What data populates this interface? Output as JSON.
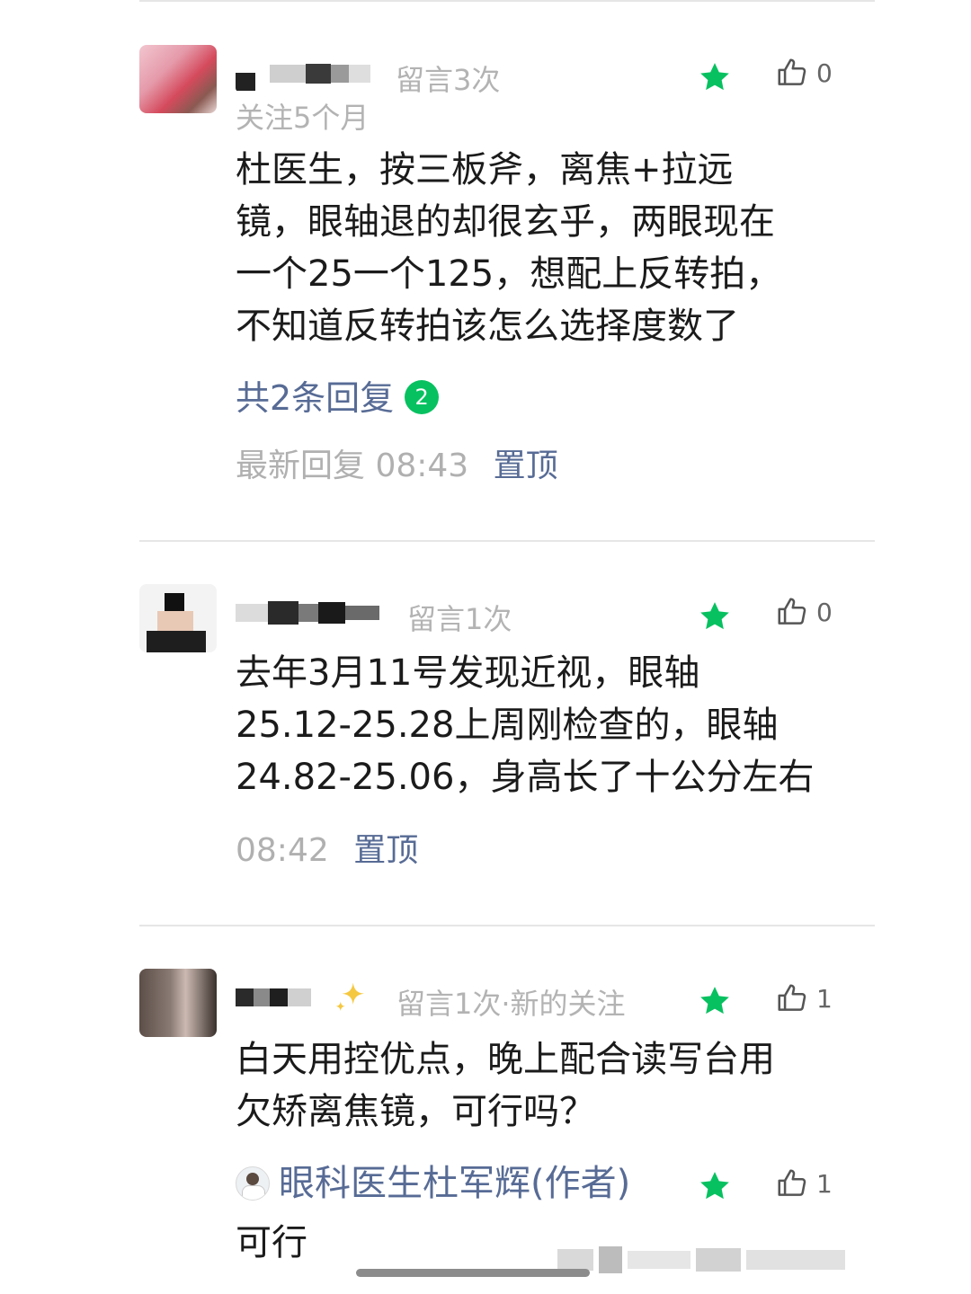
{
  "comments": [
    {
      "meta": "留言3次",
      "follow": "关注5个月",
      "lines": [
        "杜医生，按三板斧，离焦+拉远",
        "镜，眼轴退的却很玄乎，两眼现在",
        "一个25一个125，想配上反转拍，",
        "不知道反转拍该怎么选择度数了"
      ],
      "replies_label": "共2条回复",
      "replies_count": "2",
      "latest_label": "最新回复 08:43",
      "pin_label": "置顶",
      "likes": "0"
    },
    {
      "meta": "留言1次",
      "lines": [
        "去年3月11号发现近视，眼轴",
        "25.12-25.28上周刚检查的，眼轴",
        "24.82-25.06，身高长了十公分左右"
      ],
      "time": "08:42",
      "pin_label": "置顶",
      "likes": "0"
    },
    {
      "meta": "留言1次·新的关注",
      "lines": [
        "白天用控优点，晚上配合读写台用",
        "欠矫离焦镜，可行吗？"
      ],
      "likes": "1",
      "reply": {
        "author": "眼科医生杜军辉(作者)",
        "text": "可行",
        "likes": "1"
      }
    }
  ],
  "icons": {
    "star": "star-icon",
    "like": "thumbs-up-icon",
    "sparkle": "sparkle-icon"
  },
  "colors": {
    "star": "#07c160",
    "link": "#576b95",
    "badge": "#07c160"
  }
}
